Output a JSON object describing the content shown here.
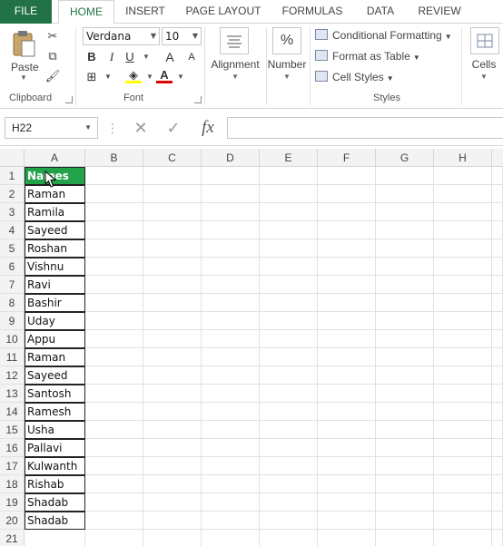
{
  "tabs": [
    "FILE",
    "HOME",
    "INSERT",
    "PAGE LAYOUT",
    "FORMULAS",
    "DATA",
    "REVIEW"
  ],
  "ribbon": {
    "clipboard": {
      "paste_label": "Paste",
      "group_label": "Clipboard"
    },
    "font": {
      "font_name": "Verdana",
      "font_size": "10",
      "bold": "B",
      "italic": "I",
      "underline": "U",
      "grow": "A",
      "shrink": "A",
      "font_color": "A",
      "group_label": "Font"
    },
    "alignment": {
      "label": "Alignment"
    },
    "number": {
      "label": "Number",
      "icon_text": "%"
    },
    "styles": {
      "conditional_formatting": "Conditional Formatting",
      "format_as_table": "Format as Table",
      "cell_styles": "Cell Styles",
      "group_label": "Styles"
    },
    "cells": {
      "label": "Cells"
    }
  },
  "formula_bar": {
    "name_box": "H22",
    "cancel": "✕",
    "enter": "✓",
    "fx": "fx",
    "formula": ""
  },
  "columns": [
    "A",
    "B",
    "C",
    "D",
    "E",
    "F",
    "G",
    "H"
  ],
  "rows": [
    "1",
    "2",
    "3",
    "4",
    "5",
    "6",
    "7",
    "8",
    "9",
    "10",
    "11",
    "12",
    "13",
    "14",
    "15",
    "16",
    "17",
    "18",
    "19",
    "20",
    "21"
  ],
  "column_a": [
    "Names",
    "Raman",
    "Ramila",
    "Sayeed",
    "Roshan",
    "Vishnu",
    "Ravi",
    "Bashir",
    "Uday",
    "Appu",
    "Raman",
    "Sayeed",
    "Santosh",
    "Ramesh",
    "Usha",
    "Pallavi",
    "Kulwanth",
    "Rishab",
    "Shadab",
    "Shadab"
  ],
  "colors": {
    "accent": "#217346",
    "header_fill": "#22a34a"
  },
  "icons": [
    "paste-icon",
    "cut-icon",
    "copy-icon",
    "format-painter-icon",
    "borders-icon",
    "fill-color-icon",
    "alignment-icon",
    "conditional-formatting-icon",
    "format-as-table-icon",
    "cell-styles-icon",
    "cells-icon",
    "cursor-icon"
  ]
}
